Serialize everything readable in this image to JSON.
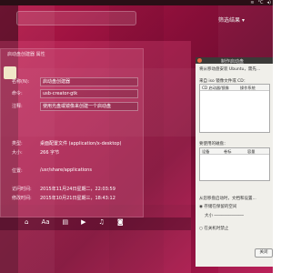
{
  "topbar": {
    "temp": "°C",
    "status_icons": [
      "wifi-icon",
      "volume-icon",
      "clock-icon"
    ]
  },
  "search": {
    "placeholder": "",
    "filter_label": "筛选结果"
  },
  "properties_window": {
    "title": "启动盘创建器 属性",
    "name_label": "名称(N):",
    "name_value": "启动盘创建器",
    "command_label": "命令:",
    "command_value": "usb-creator-gtk",
    "comment_label": "注释:",
    "comment_value": "使用光盘或镜像来创建一个启动盘",
    "type_label": "类型:",
    "type_value": "桌面配置文件 (application/x-desktop)",
    "size_label": "大小:",
    "size_value": "266 字节",
    "location_label": "位置:",
    "location_value": "/usr/share/applications",
    "accessed_label": "访问时间:",
    "accessed_value": "2015年11月24日星期二，22:03:59",
    "modified_label": "修改时间:",
    "modified_value": "2015年10月21日星期三，18:43:12"
  },
  "dock": {
    "items": [
      "⌂",
      "Aa",
      "▤",
      "▶",
      "♫",
      "◙"
    ]
  },
  "dialog": {
    "title": "制作启动盘",
    "intro": "将从移动盘安装 Ubuntu，需先...",
    "source_label": "来自 iso 镜像文件或 CD：",
    "source_col1": "CD 启动器/镜像",
    "source_col2": "操作系统",
    "target_label": "要使用的磁盘：",
    "col_device": "设备",
    "col_label": "卷标",
    "col_capacity": "容量",
    "opt1": "从您移盘启动时，文档和设置...",
    "opt2": "存储在保留的空间",
    "opt3": "大小",
    "opt4": "在关机时禁止",
    "close_button": "关闭"
  }
}
